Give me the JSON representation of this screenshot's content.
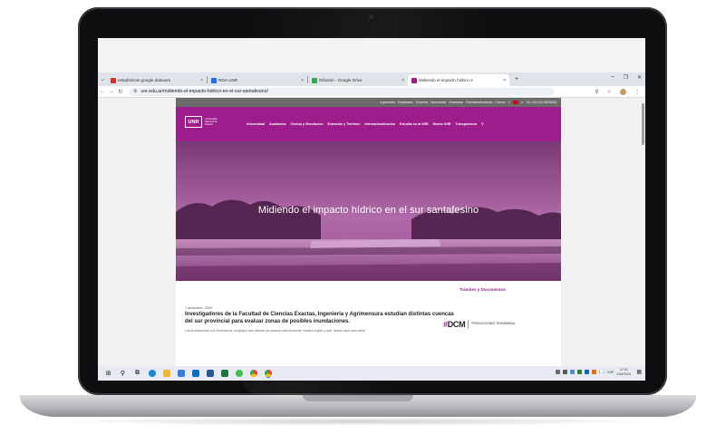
{
  "browser": {
    "tabs": [
      {
        "label": "estadísticas google datavers",
        "color": "#d93025",
        "active": false
      },
      {
        "label": "RDA-UNR",
        "color": "#1a73e8",
        "active": false
      },
      {
        "label": "Difusión - Google Drive",
        "color": "#34a853",
        "active": false
      },
      {
        "label": "Midiendo el impacto hídrico s",
        "color": "#9c1d8b",
        "active": true
      }
    ],
    "new_tab_label": "+",
    "url": "unr.edu.ar/midiendo-el-impacto-hidrico-en-el-sur-santafesino/"
  },
  "site": {
    "topbar_links": [
      "Ingresantes",
      "Estudiantes",
      "Docentes",
      "Nodocentes",
      "Graduados",
      "Facultades/Institutos",
      "Correos"
    ],
    "topbar_phone": "341-4201200 WEBMAIL",
    "logo": {
      "abbr": "UNR",
      "name": "Universidad Nacional de Rosario"
    },
    "menu": [
      "Universidad",
      "Académica",
      "Ciencia y Vinculación",
      "Extensión y Territorio",
      "Internacionalización",
      "Estudiar en la UNR",
      "Mucho UNR",
      "Transparencia"
    ],
    "hero_title": "Midiendo el impacto hídrico en el sur santafesino",
    "date": "1 diciembre, 2020",
    "lead": "Investigadores de la Facultad de Ciencias Exactas, Ingeniería y Agrimensura estudian distintas cuencas del sur provincial para evaluar zonas de posibles inundaciones.",
    "body": "Las inundaciones son fenómenos complejos que afectan de manera más frecuente nuestra región y que, desde hace unos años",
    "sidebar_title": "Trámites y Documentos",
    "dcm": {
      "hash": "#",
      "brand": "DCM",
      "tagline": "PRODUCCIONES TRANSMEDIA"
    }
  },
  "taskbar": {
    "language": "ESP",
    "time": "17:01",
    "date": "23/4/2024"
  },
  "colors": {
    "unr_magenta": "#9c1d8b",
    "topbar_gray": "#6b6b6b"
  }
}
